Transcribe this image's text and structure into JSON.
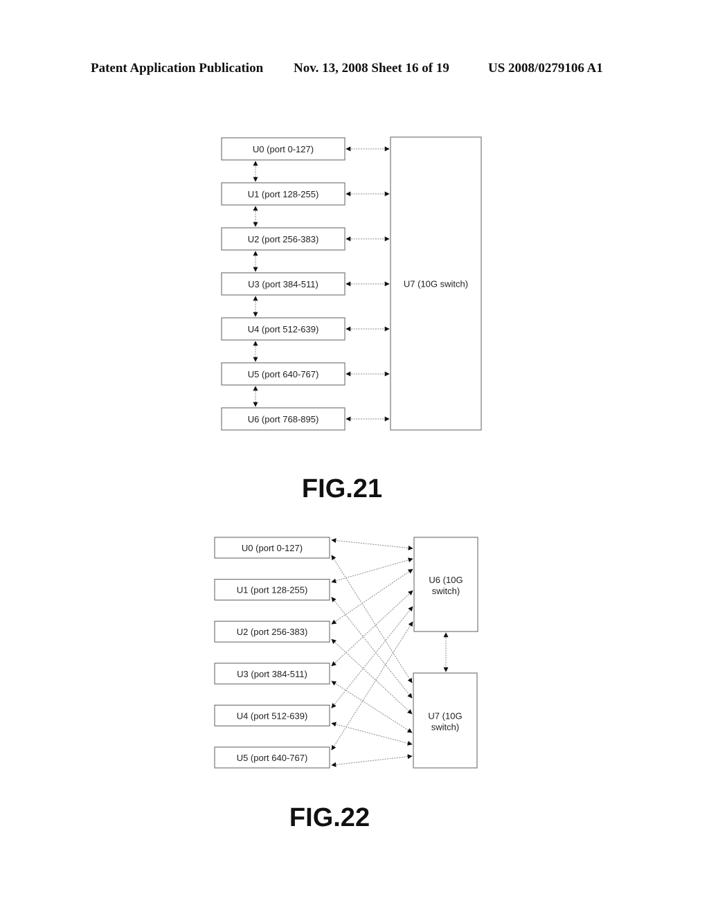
{
  "header": {
    "left": "Patent Application Publication",
    "middle": "Nov. 13, 2008  Sheet 16 of 19",
    "right": "US 2008/0279106 A1"
  },
  "fig21": {
    "caption": "FIG.21",
    "units": [
      "U0 (port 0-127)",
      "U1 (port 128-255)",
      "U2 (port 256-383)",
      "U3 (port 384-511)",
      "U4 (port 512-639)",
      "U5 (port 640-767)",
      "U6 (port 768-895)"
    ],
    "switch": "U7 (10G switch)",
    "connections": "each unit bidirectionally linked to adjacent unit and to U7"
  },
  "fig22": {
    "caption": "FIG.22",
    "units": [
      "U0 (port 0-127)",
      "U1 (port 128-255)",
      "U2 (port 256-383)",
      "U3 (port 384-511)",
      "U4 (port 512-639)",
      "U5 (port 640-767)"
    ],
    "switches": [
      [
        "U6 (10G",
        "switch)"
      ],
      [
        "U7 (10G",
        "switch)"
      ]
    ],
    "connections": "each unit bidirectionally linked to both U6 and U7; U6 linked to U7"
  }
}
